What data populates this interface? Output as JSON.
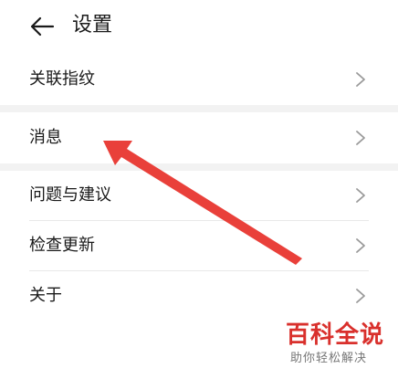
{
  "header": {
    "title": "设置"
  },
  "menu": {
    "items": [
      {
        "label": "关联指纹"
      },
      {
        "label": "消息"
      },
      {
        "label": "问题与建议"
      },
      {
        "label": "检查更新"
      },
      {
        "label": "关于"
      }
    ]
  },
  "watermark": {
    "title": "百科全说",
    "subtitle": "助你轻松解决"
  },
  "colors": {
    "annotation_arrow": "#e8362f",
    "watermark": "#d9302c",
    "separator": "#f2f2f2"
  },
  "icons": {
    "back": "arrow-left-icon",
    "chevron": "chevron-right-icon"
  }
}
